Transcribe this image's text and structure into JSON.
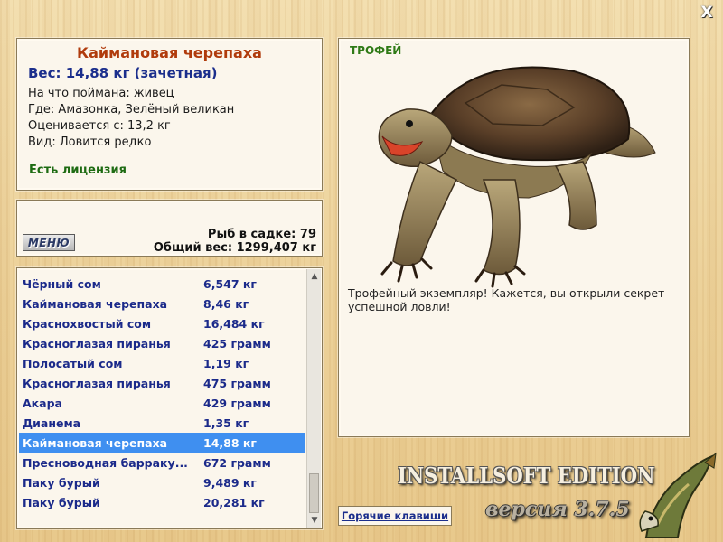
{
  "window": {
    "close_glyph": "X"
  },
  "info": {
    "fish_name": "Каймановая черепаха",
    "weight": "Вес: 14,88 кг (зачетная)",
    "caught_on": "На что поймана: живец",
    "location": "Где: Амазонка, Зелёный великан",
    "value": "Оценивается с: 13,2 кг",
    "kind": "Вид: Ловится редко",
    "license": "Есть лицензия"
  },
  "cage": {
    "menu_label": "МЕНЮ",
    "fish_count": "Рыб в садке: 79",
    "total_weight": "Общий вес: 1299,407 кг"
  },
  "catch_list": {
    "selected_index": 8,
    "rows": [
      {
        "name": "Чёрный сом",
        "weight": "6,547 кг"
      },
      {
        "name": "Каймановая черепаха",
        "weight": "8,46 кг"
      },
      {
        "name": "Краснохвостый сом",
        "weight": "16,484 кг"
      },
      {
        "name": "Красноглазая пиранья",
        "weight": "425 грамм"
      },
      {
        "name": "Полосатый сом",
        "weight": "1,19 кг"
      },
      {
        "name": "Красноглазая пиранья",
        "weight": "475 грамм"
      },
      {
        "name": "Акара",
        "weight": "429 грамм"
      },
      {
        "name": "Дианема",
        "weight": "1,35 кг"
      },
      {
        "name": "Каймановая черепаха",
        "weight": "14,88 кг"
      },
      {
        "name": "Пресноводная барраку...",
        "weight": "672 грамм"
      },
      {
        "name": "Паку бурый",
        "weight": "9,489 кг"
      },
      {
        "name": "Паку бурый",
        "weight": "20,281 кг"
      }
    ]
  },
  "trophy": {
    "label": "ТРОФЕЙ",
    "text": "Трофейный экземпляр! Кажется, вы открыли секрет успешной ловли!"
  },
  "footer": {
    "edition": "INSTALLSOFT EDITION",
    "version": "версия 3.7.5",
    "hotkeys": "Горячие клавиши"
  },
  "colors": {
    "fish_name": "#b03b0c",
    "list_text": "#1b2a8a",
    "selection": "#3f8ff0",
    "license": "#1d6b12"
  }
}
